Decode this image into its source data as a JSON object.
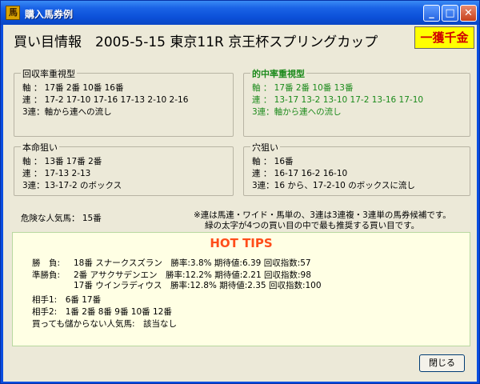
{
  "window": {
    "title": "購入馬券例",
    "icon_glyph": "馬",
    "controls": {
      "minimize": "_",
      "maximize": "□",
      "close": "✕"
    }
  },
  "header": {
    "headline": "買い目情報　2005-5-15 東京11R 京王杯スプリングカップ",
    "jackpot_badge": "一獲千金",
    "jackpot_colors": {
      "bg": "#ffff00",
      "text": "#d00000"
    }
  },
  "groups": {
    "recovery": {
      "title": "回収率重視型",
      "lines": [
        "軸 ： 17番 2番 10番 16番",
        "連 ： 17-2  17-10  17-16  17-13  2-10  2-16",
        "3連：軸から連への流し"
      ]
    },
    "hitrate": {
      "title": "的中率重視型",
      "lines": [
        "軸 ： 17番 2番 10番 13番",
        "連 ： 13-17  13-2  13-10  17-2  13-16  17-10",
        "3連：軸から連への流し"
      ]
    },
    "favorite": {
      "title": "本命狙い",
      "lines": [
        "軸 ： 13番 17番 2番",
        "連 ： 17-13  2-13",
        "3連：13-17-2 のボックス"
      ]
    },
    "longshot": {
      "title": "穴狙い",
      "lines": [
        "軸 ： 16番",
        "連 ： 16-17  16-2  16-10",
        "3連：16 から、17-2-10 のボックスに流し"
      ]
    }
  },
  "danger": "危険な人気馬： 15番",
  "notes": [
    "※連は馬連・ワイド・馬単の、3連は3連複・3連単の馬券候補です。",
    "緑の太字が4つの買い目の中で最も推奨する買い目です。"
  ],
  "hot_tips": {
    "title": "HOT TIPS",
    "winner_label": "勝　負:",
    "winner": "18番 スナークスズラン　勝率:3.8% 期待値:6.39 回収指数:57",
    "runnerup_label": "準勝負:",
    "runnerup": [
      "2番 アサクサデンエン　勝率:12.2% 期待値:2.21 回収指数:98",
      "17番 ウインラディウス　勝率:12.8% 期待値:2.35 回収指数:100"
    ],
    "partner1": "相手1:　6番  17番",
    "partner2": "相手2:　1番  2番  8番  9番  10番  12番",
    "unprofitable": "買っても儲からない人気馬:　該当なし"
  },
  "buttons": {
    "close": "閉じる"
  },
  "colors": {
    "titlebar": "#0a4ee0",
    "panel": "#ece9d8",
    "green": "#1b8a1b",
    "tips_title": "#ff4d1a",
    "tips_bg": "#ffffe4"
  }
}
